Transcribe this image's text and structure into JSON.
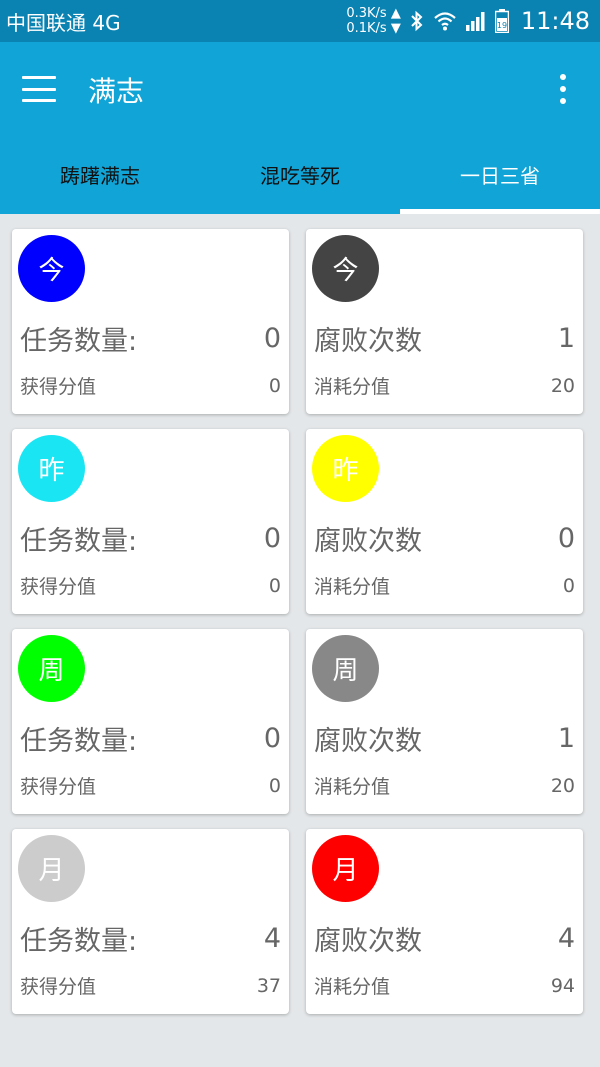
{
  "status_bar": {
    "carrier": "中国联通 4G",
    "speed_up": "0.3K/s ▲",
    "speed_down": "0.1K/s ▼",
    "battery_level": "19",
    "time": "11:48",
    "icons": [
      "bluetooth-icon",
      "wifi-icon",
      "signal-icon",
      "battery-icon"
    ]
  },
  "app_bar": {
    "title": "满志",
    "menu_icon": "hamburger-menu-icon",
    "overflow_icon": "more-vert-icon",
    "tabs": [
      {
        "label": "踌躇满志",
        "active": false
      },
      {
        "label": "混吃等死",
        "active": false
      },
      {
        "label": "一日三省",
        "active": true
      }
    ]
  },
  "cards": [
    {
      "badge": "今",
      "badge_color": "#0000ff",
      "main_label": "任务数量:",
      "main_value": "0",
      "sub_label": "获得分值",
      "sub_value": "0"
    },
    {
      "badge": "今",
      "badge_color": "#444444",
      "main_label": "腐败次数",
      "main_value": "1",
      "sub_label": "消耗分值",
      "sub_value": "20"
    },
    {
      "badge": "昨",
      "badge_color": "#1ae5f2",
      "main_label": "任务数量:",
      "main_value": "0",
      "sub_label": "获得分值",
      "sub_value": "0"
    },
    {
      "badge": "昨",
      "badge_color": "#ffff00",
      "main_label": "腐败次数",
      "main_value": "0",
      "sub_label": "消耗分值",
      "sub_value": "0"
    },
    {
      "badge": "周",
      "badge_color": "#00ff00",
      "main_label": "任务数量:",
      "main_value": "0",
      "sub_label": "获得分值",
      "sub_value": "0"
    },
    {
      "badge": "周",
      "badge_color": "#888888",
      "main_label": "腐败次数",
      "main_value": "1",
      "sub_label": "消耗分值",
      "sub_value": "20"
    },
    {
      "badge": "月",
      "badge_color": "#cccccc",
      "main_label": "任务数量:",
      "main_value": "4",
      "sub_label": "获得分值",
      "sub_value": "37"
    },
    {
      "badge": "月",
      "badge_color": "#ff0000",
      "main_label": "腐败次数",
      "main_value": "4",
      "sub_label": "消耗分值",
      "sub_value": "94"
    }
  ]
}
